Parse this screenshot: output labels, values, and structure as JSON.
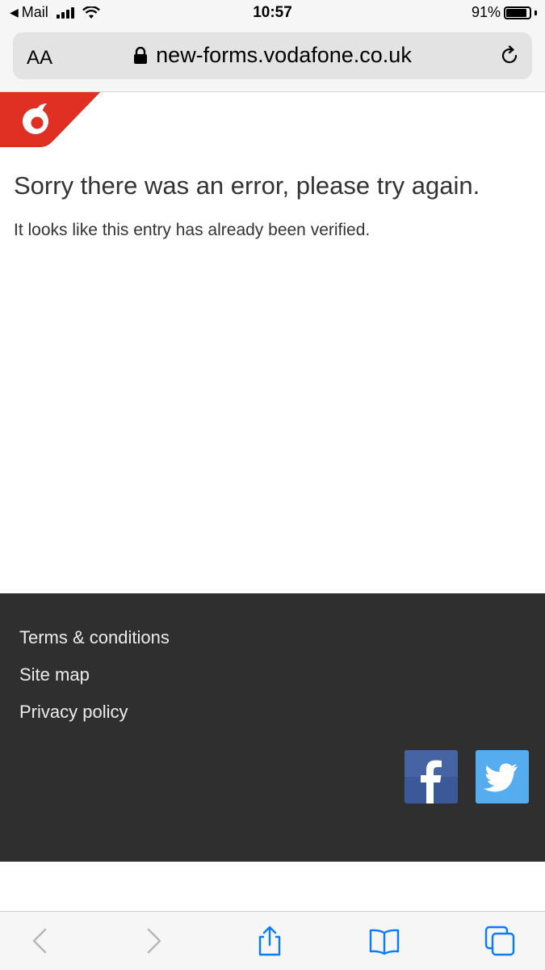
{
  "status_bar": {
    "back_app": "Mail",
    "time": "10:57",
    "battery_percent": "91%",
    "battery_level": 0.91
  },
  "browser": {
    "text_size_label": "AA",
    "url": "new-forms.vodafone.co.uk"
  },
  "page": {
    "heading": "Sorry there was an error, please try again.",
    "message": "It looks like this entry has already been verified."
  },
  "footer": {
    "links": [
      "Terms & conditions",
      "Site map",
      "Privacy policy"
    ],
    "social": [
      "facebook-icon",
      "twitter-icon"
    ]
  },
  "colors": {
    "vodafone_red": "#e60000",
    "footer_bg": "#2f2f2f",
    "facebook": "#3b5998",
    "twitter": "#55acee",
    "toolbar_active": "#0a7aff"
  },
  "toolbar": {
    "icons": [
      "back-icon",
      "forward-icon",
      "share-icon",
      "bookmarks-icon",
      "tabs-icon"
    ]
  }
}
